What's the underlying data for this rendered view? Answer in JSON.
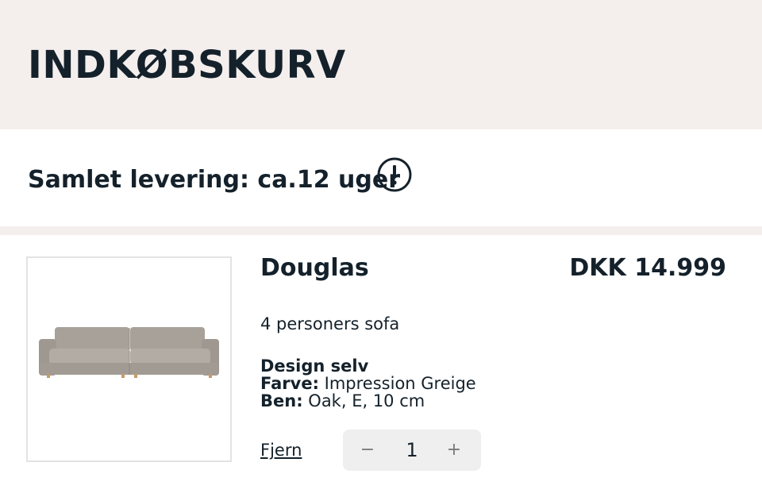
{
  "header": {
    "title": "INDKØBSKURV"
  },
  "delivery": {
    "text": "Samlet levering: ca.12 uger",
    "icon": "exclamation-circle-icon"
  },
  "cart": {
    "item": {
      "image_alt": "sofa-image",
      "name": "Douglas",
      "price": "DKK 14.999",
      "subtitle": "4 personers sofa",
      "design_label": "Design selv",
      "color_label": "Farve:",
      "color_value": " Impression Greige",
      "legs_label": "Ben:",
      "legs_value": " Oak, E, 10 cm",
      "remove_label": "Fjern",
      "quantity": "1",
      "minus_label": "−",
      "plus_label": "+"
    }
  },
  "colors": {
    "header_bg": "#f4efed",
    "text": "#14212b",
    "stepper_bg": "#efefef",
    "sofa": "#a9a29b"
  }
}
